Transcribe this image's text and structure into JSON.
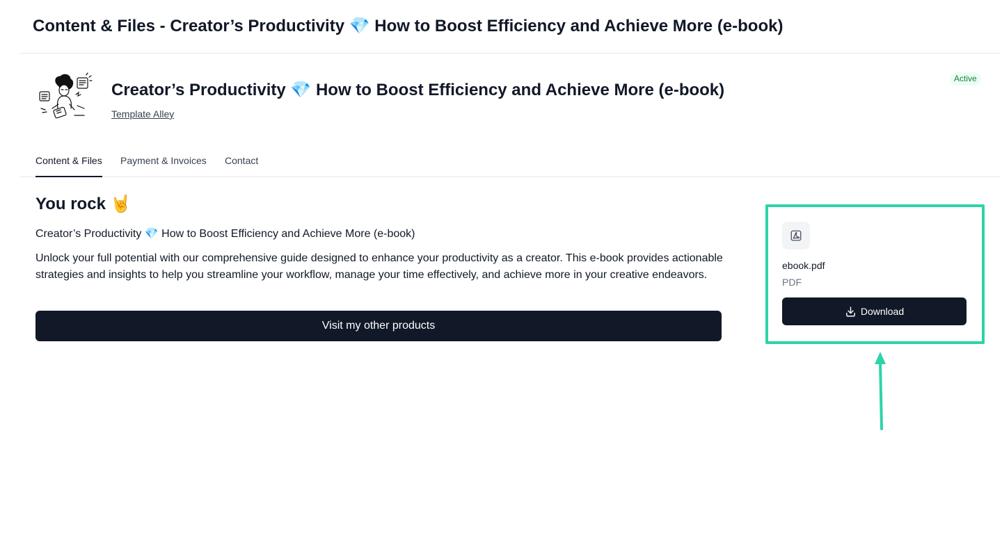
{
  "header": {
    "title": "Content & Files - Creator’s Productivity 💎 How to Boost Efficiency and Achieve More (e-book)"
  },
  "product": {
    "title": "Creator’s Productivity 💎 How to Boost Efficiency and Achieve More (e-book)",
    "creator": "Template Alley",
    "status": "Active",
    "thumbnail_icon": "person-working-illustration"
  },
  "tabs": [
    {
      "label": "Content & Files",
      "active": true
    },
    {
      "label": "Payment & Invoices",
      "active": false
    },
    {
      "label": "Contact",
      "active": false
    }
  ],
  "content": {
    "heading": "You rock 🤘",
    "product_name": "Creator’s Productivity 💎 How to Boost Efficiency and Achieve More (e-book)",
    "description": "Unlock your full potential with our comprehensive guide designed to enhance your productivity as a creator. This e-book provides actionable strategies and insights to help you streamline your workflow, manage your time effectively, and achieve more in your creative endeavors.",
    "visit_button": "Visit my other products"
  },
  "file": {
    "name": "ebook.pdf",
    "type": "PDF",
    "icon": "pdf-file-icon",
    "download_label": "Download",
    "download_icon": "download-icon"
  },
  "colors": {
    "primary": "#111827",
    "highlight": "#2dd4a7",
    "status_bg": "#ecfdf3",
    "status_text": "#15803d"
  }
}
